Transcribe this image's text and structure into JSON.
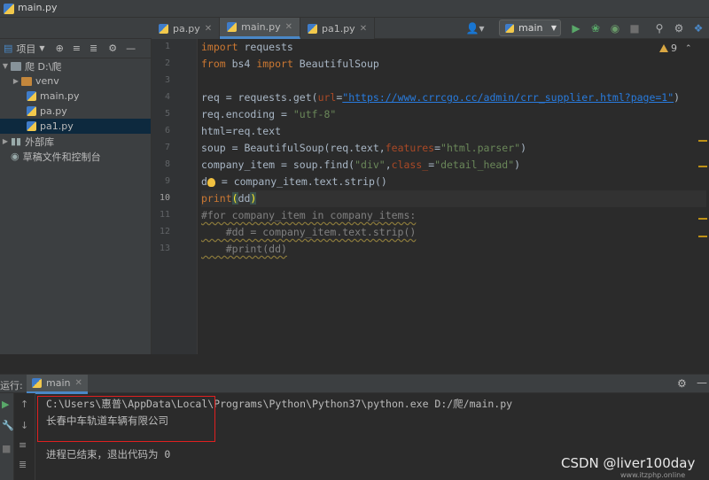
{
  "window": {
    "title": "main.py"
  },
  "toolbar": {
    "run_config": "main"
  },
  "project": {
    "header_label": "项目",
    "items": [
      {
        "label": "爬 D:\\爬",
        "kind": "folder"
      },
      {
        "label": "venv",
        "kind": "folder-orange"
      },
      {
        "label": "main.py",
        "kind": "py"
      },
      {
        "label": "pa.py",
        "kind": "py"
      },
      {
        "label": "pa1.py",
        "kind": "py"
      },
      {
        "label": "外部库",
        "kind": "lib"
      },
      {
        "label": "草稿文件和控制台",
        "kind": "scratch"
      }
    ]
  },
  "tabs": [
    {
      "label": "pa.py"
    },
    {
      "label": "main.py"
    },
    {
      "label": "pa1.py"
    }
  ],
  "editor": {
    "warning_count": "9",
    "line_numbers": [
      "1",
      "2",
      "3",
      "4",
      "5",
      "6",
      "7",
      "8",
      "9",
      "10",
      "11",
      "12",
      "13"
    ],
    "lines": {
      "l1_kw": "import",
      "l1_rest": " requests",
      "l2_kw1": "from",
      "l2_mod": " bs4 ",
      "l2_kw2": "import",
      "l2_rest": " BeautifulSoup",
      "l4_a": "req = requests.get(",
      "l4_kwarg": "url",
      "l4_eq": "=",
      "l4_url": "\"https://www.crrcgo.cc/admin/crr_supplier.html?page=1\"",
      "l4_end": ")",
      "l5_a": "req.encoding = ",
      "l5_str": "\"utf-8\"",
      "l6": "html=req.text",
      "l7_a": "soup = BeautifulSoup(req.text,",
      "l7_kwarg": "features",
      "l7_eq": "=",
      "l7_str": "\"html.parser\"",
      "l7_end": ")",
      "l8_a": "company_item = soup.find(",
      "l8_str1": "\"div\"",
      "l8_c": ",",
      "l8_kwarg": "class_",
      "l8_eq": "=",
      "l8_str2": "\"detail_head\"",
      "l8_end": ")",
      "l9_a": "d",
      "l9_b": " = company_item.text.strip()",
      "l10_a": "print",
      "l10_b": "(",
      "l10_c": "dd",
      "l10_d": ")",
      "l11": "#for company_item in company_items:",
      "l12": "    #dd = company_item.text.strip()",
      "l13": "    #print(dd)"
    }
  },
  "run": {
    "panel_label": "运行:",
    "tab_label": "main",
    "console": [
      "C:\\Users\\惠普\\AppData\\Local\\Programs\\Python\\Python37\\python.exe D:/爬/main.py",
      "长春中车轨道车辆有限公司",
      "进程已结束，退出代码为 0"
    ]
  },
  "watermark": {
    "text": "CSDN @liver100day",
    "sub": "www.itzphp.online"
  }
}
